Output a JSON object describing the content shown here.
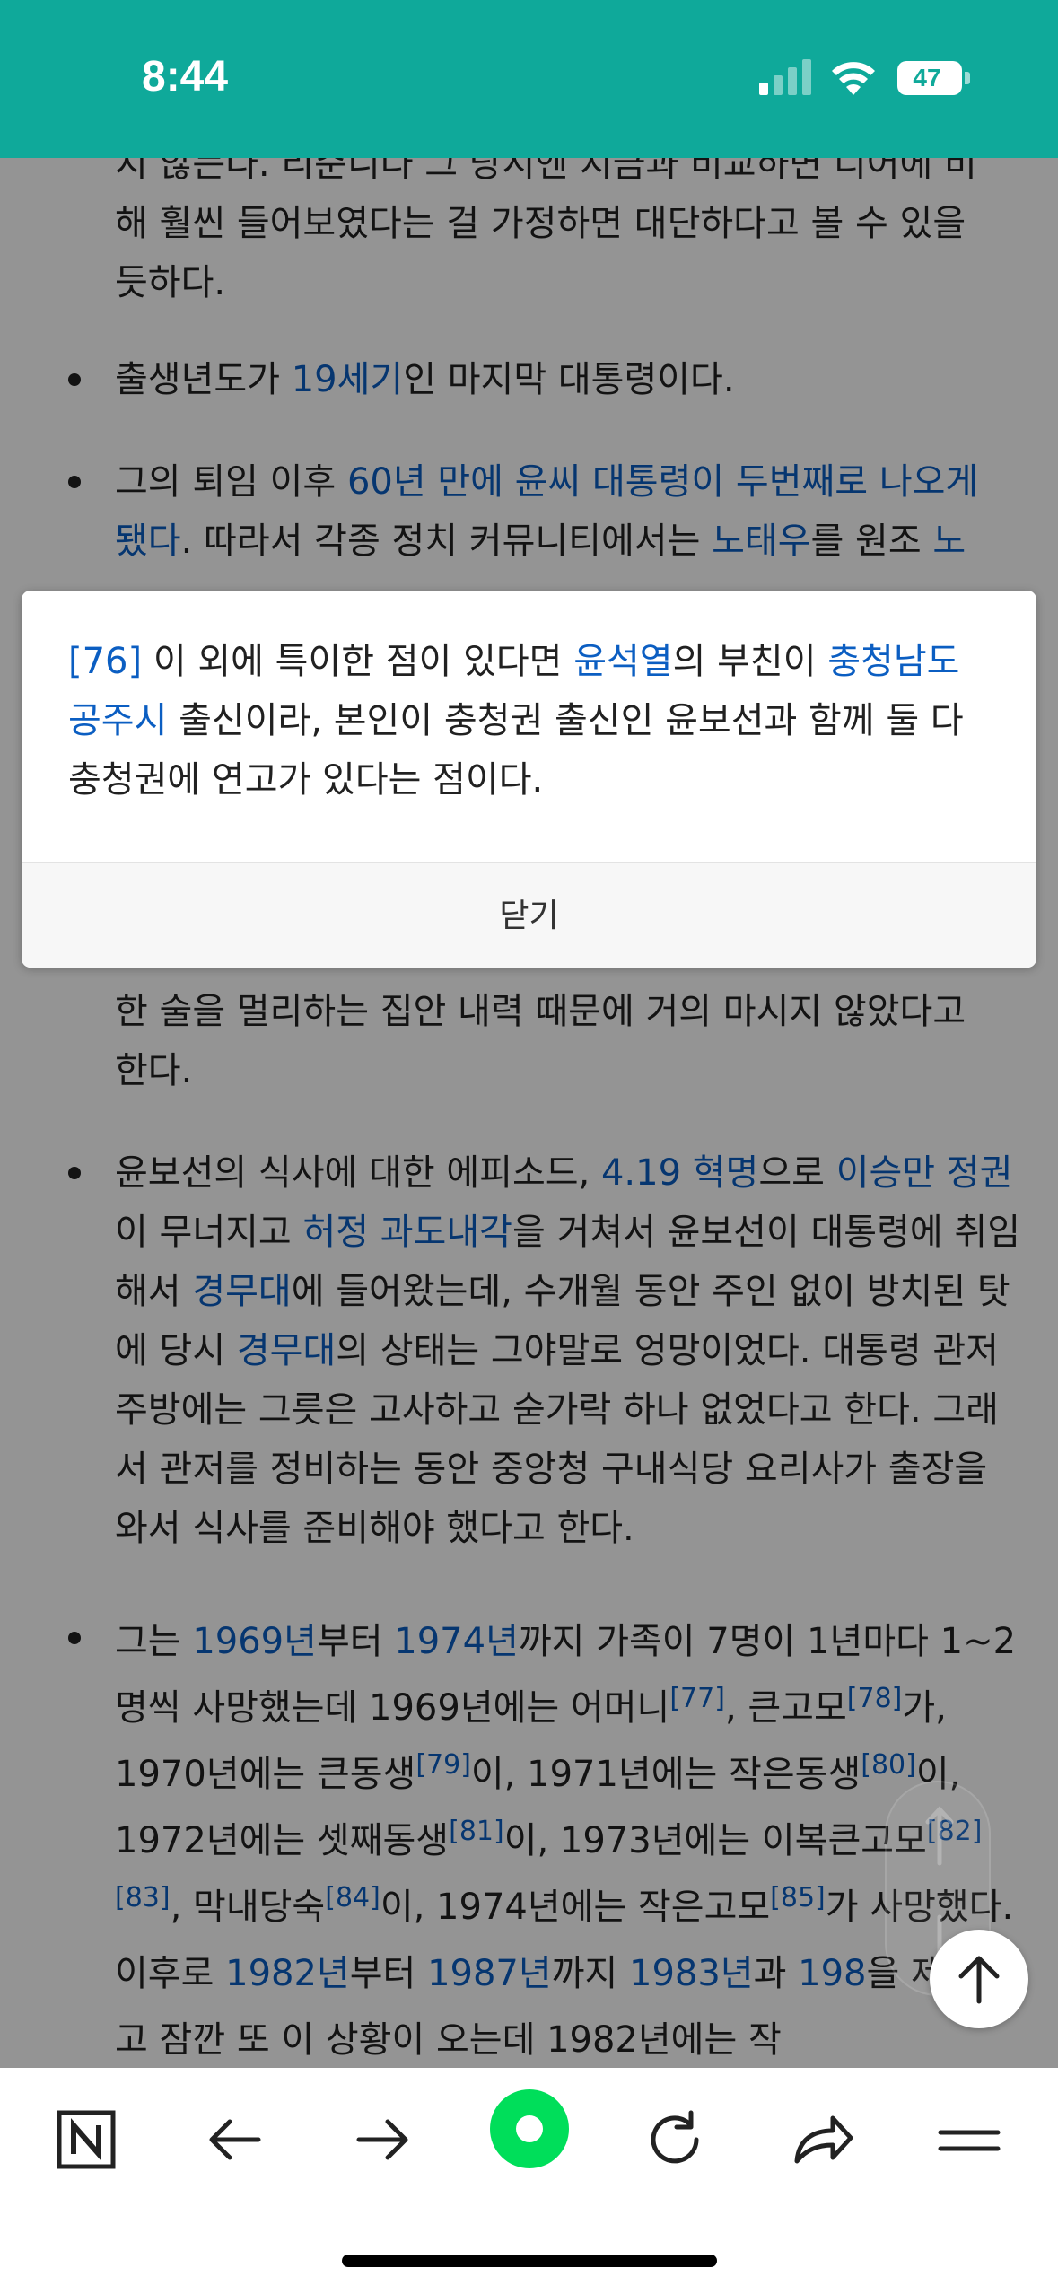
{
  "status_bar": {
    "time": "8:44",
    "battery": "47",
    "color": "#0fa99a"
  },
  "article": {
    "fragment_line1": "지 않는다. 리준니다 그 당시엔 지금과 비교하면 디어에 비",
    "fragment_line2": "해 훨씬 들어보였다는 걸 가정하면 대단하다고 볼 수 있을",
    "fragment_line3": "듯하다.",
    "b1_pre": "출생년도가 ",
    "b1_link": "19세기",
    "b1_post": "인 마지막 대통령이다.",
    "b2_pre": "그의 퇴임 이후 ",
    "b2_link1": "60년 만에 윤씨 대통령이 두번째로 나오게 됐다",
    "b2_mid": ". 따라서 각종 정치 커뮤니티에서는 ",
    "b2_link2": "노태우",
    "b2_mid2": "를 원조 ",
    "b2_link3": "노",
    "b3_line1": "한 술을 멀리하는 집안 내력 때문에 거의 마시지 않았다고",
    "b3_line2": "한다.",
    "b4_pre": "윤보선의 식사에 대한 에피소드, ",
    "b4_link1": "4.19 혁명",
    "b4_mid1": "으로 ",
    "b4_link2": "이승만 정권",
    "b4_mid2": "이 무너지고 ",
    "b4_link3": "허정 과도내각",
    "b4_mid3": "을 거쳐서 윤보선이 대통령에 취임해서 ",
    "b4_link4": "경무대",
    "b4_mid4": "에 들어왔는데, 수개월 동안 주인 없이 방치된 탓에 당시 ",
    "b4_link5": "경무대",
    "b4_post": "의 상태는 그야말로 엉망이었다. 대통령 관저 주방에는 그릇은 고사하고 숟가락 하나 없었다고 한다. 그래서 관저를 정비하는 동안 중앙청 구내식당 요리사가 출장을 와서 식사를 준비해야 했다고 한다.",
    "b5_pre": "그는 ",
    "b5_link1": "1969년",
    "b5_t1": "부터 ",
    "b5_link2": "1974년",
    "b5_t2": "까지 가족이 7명이 1년마다 1~2명씩 사망했는데 1969년에는 어머니",
    "b5_ref77": "[77]",
    "b5_t3": ", 큰고모",
    "b5_ref78": "[78]",
    "b5_t4": "가, 1970년에는 큰동생",
    "b5_ref79": "[79]",
    "b5_t5": "이, 1971년에는 작은동생",
    "b5_ref80": "[80]",
    "b5_t6": "이, 1972년에는 셋째동생",
    "b5_ref81": "[81]",
    "b5_t7": "이, 1973년에는 이복큰고모",
    "b5_ref82": "[82]",
    "b5_ref83": "[83]",
    "b5_t8": ", 막내당숙",
    "b5_ref84": "[84]",
    "b5_t9": "이, 1974년에는 작은고모",
    "b5_ref85": "[85]",
    "b5_t10": "가 사망했다. 이후로 ",
    "b5_link3": "1982년",
    "b5_t11": "부터 ",
    "b5_link4": "1987년",
    "b5_t12": "까지 ",
    "b5_link5": "1983년",
    "b5_t13": "과 ",
    "b5_link6": "198",
    "b5_t14": "을 제외하고 잠깐 또 이 상황이 오는데 1982년에는 작"
  },
  "footnote_popup": {
    "ref": "[76]",
    "text_pre": " 이 외에 특이한 점이 있다면 ",
    "link1": "윤석열",
    "text_mid1": "의 부친이 ",
    "link2": "충청남도 공주시",
    "text_post": " 출신이라, 본인이 충청권 출신인 윤보선과 함께 둘 다 충청권에 연고가 있다는 점이다.",
    "close_label": "닫기"
  },
  "toolbar": {
    "items": [
      "naver-home",
      "back",
      "forward",
      "green-dot",
      "reload",
      "share",
      "menu"
    ],
    "home_label": "N",
    "accent": "#00de5a"
  },
  "colors": {
    "link": "#0b5ec2"
  }
}
